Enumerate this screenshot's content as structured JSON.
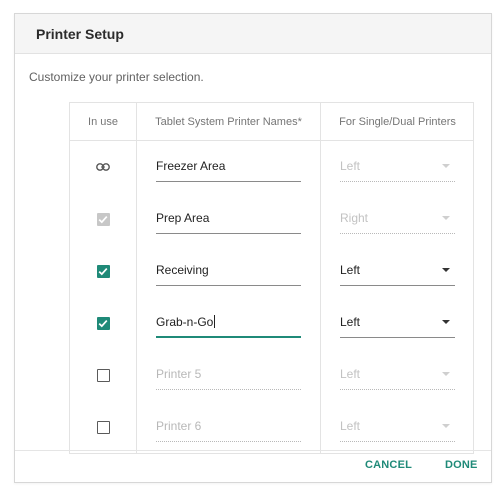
{
  "dialog": {
    "title": "Printer Setup",
    "subtitle": "Customize your printer selection."
  },
  "table": {
    "headers": [
      "In use",
      "Tablet System Printer Names*",
      "For Single/Dual Printers"
    ],
    "rows": [
      {
        "in_use": "link-icon",
        "name": "Freezer Area",
        "side": "Left",
        "enabled": false
      },
      {
        "in_use": "checked-disabled",
        "name": "Prep Area",
        "side": "Right",
        "enabled": false
      },
      {
        "in_use": "checked",
        "name": "Receiving",
        "side": "Left",
        "enabled": true
      },
      {
        "in_use": "checked",
        "name": "Grab-n-Go",
        "side": "Left",
        "enabled": true,
        "focused": true
      },
      {
        "in_use": "unchecked",
        "name_placeholder": "Printer 5",
        "side": "Left",
        "enabled": false
      },
      {
        "in_use": "unchecked",
        "name_placeholder": "Printer 6",
        "side": "Left",
        "enabled": false
      }
    ]
  },
  "footer": {
    "cancel_label": "CANCEL",
    "done_label": "DONE"
  },
  "colors": {
    "accent": "#1f8a78",
    "header_bg": "#f5f5f5"
  }
}
